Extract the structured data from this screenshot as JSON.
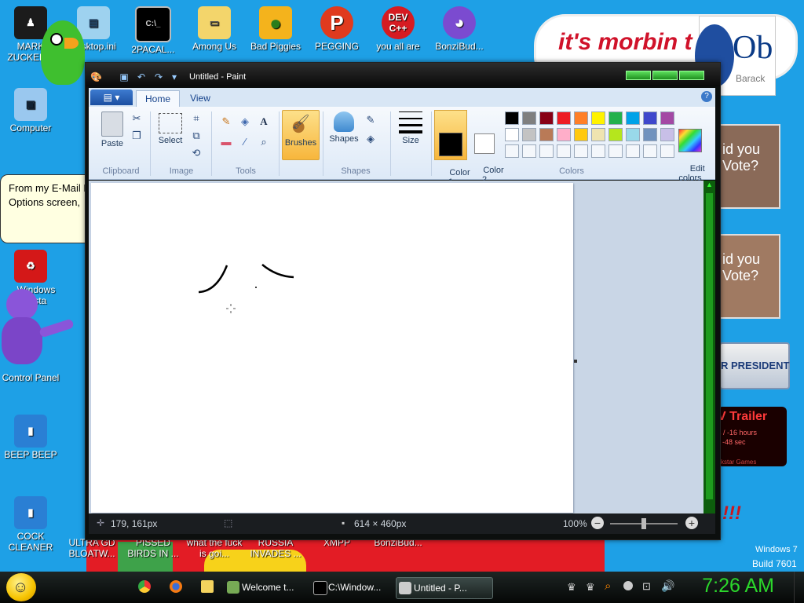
{
  "desktop_icons": [
    {
      "label": "MARK ZUCKER...",
      "icon": "user-icon"
    },
    {
      "label": "desktop.ini",
      "icon": "file-icon"
    },
    {
      "label": "2PACAL...",
      "icon": "terminal-icon"
    },
    {
      "label": "Among Us",
      "icon": "drive-icon"
    },
    {
      "label": "Bad Piggies",
      "icon": "pig-icon"
    },
    {
      "label": "PEGGING",
      "icon": "p-icon"
    },
    {
      "label": "you all are",
      "icon": "devcpp-icon"
    },
    {
      "label": "BonziBud...",
      "icon": "bonzi-icon"
    },
    {
      "label": "Computer",
      "icon": "computer-icon"
    },
    {
      "label": "Windows Vista",
      "icon": "recycle-bin-icon"
    },
    {
      "label": "Control Panel",
      "icon": "control-panel-icon"
    },
    {
      "label": "BEEP BEEP",
      "icon": "book-icon"
    },
    {
      "label": "COCK CLEANER",
      "icon": "book-icon"
    },
    {
      "label": "ULTRA GD BLOATW...",
      "icon": "app-icon"
    },
    {
      "label": "PISSED BIRDS IN ...",
      "icon": "app-icon"
    },
    {
      "label": "what the fuck is goi...",
      "icon": "app-icon"
    },
    {
      "label": "RUSSIA INVADES ...",
      "icon": "app-icon"
    },
    {
      "label": "XMPP",
      "icon": "app-icon"
    },
    {
      "label": "BonziBud...",
      "icon": "bonzi-icon"
    }
  ],
  "background_art": {
    "banner_text": "it's morbin t",
    "poster_text": "Ob",
    "poster_sub": "Barack",
    "vote_card_1": "id you\nVote?",
    "vote_card_2": "id you\nVote?",
    "president_btn": "R PRESIDENT",
    "trailer_title": "V Trailer",
    "trailer_line1": "s / -16 hours",
    "trailer_line2": "-48 sec",
    "trailer_line3": "ckstar Games",
    "exclaim": "!!!",
    "windows_build_1": "Windows 7",
    "windows_build_2": "Build 7601"
  },
  "bubble": {
    "text": "From my E-Mail Reader Options screen,"
  },
  "paint": {
    "title": "Untitled - Paint",
    "tabs": [
      "Home",
      "View"
    ],
    "groups": {
      "clipboard": "Clipboard",
      "image": "Image",
      "tools": "Tools",
      "shapes": "Shapes",
      "colors": "Colors"
    },
    "buttons": {
      "paste": "Paste",
      "select": "Select",
      "brushes": "Brushes",
      "shapes": "Shapes",
      "size": "Size",
      "color1": "Color\n1",
      "color2": "Color\n2",
      "edit_colors": "Edit\ncolors"
    },
    "palette_row1": [
      "#000000",
      "#7f7f7f",
      "#880015",
      "#ed1c24",
      "#ff7f27",
      "#fff200",
      "#22b14c",
      "#00a2e8",
      "#3f48cc",
      "#a349a4"
    ],
    "palette_row2": [
      "#ffffff",
      "#c3c3c3",
      "#b97a57",
      "#ffaec9",
      "#ffc90e",
      "#efe4b0",
      "#b5e61d",
      "#99d9ea",
      "#7092be",
      "#c8bfe7"
    ],
    "color1_value": "#000000",
    "color2_value": "#ffffff",
    "status": {
      "cursor": "179, 161px",
      "size": "614 × 460px",
      "zoom": "100%"
    }
  },
  "taskbar": {
    "buttons": [
      "Welcome t...",
      "C:\\Window...",
      "Untitled - P..."
    ],
    "clock": "7:26 AM"
  }
}
